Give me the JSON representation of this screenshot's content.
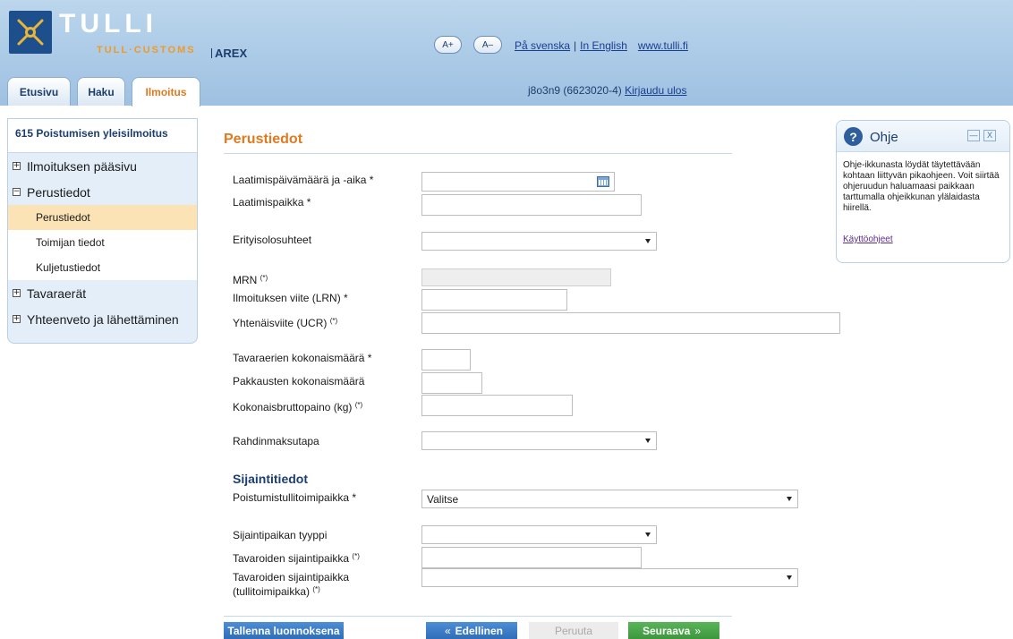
{
  "header": {
    "logo_title": "TULLI",
    "logo_sub": "TULL·CUSTOMS",
    "app_name": "AREX",
    "font_increase": "A+",
    "font_decrease": "A–",
    "lang_swedish": "På svenska",
    "lang_separator": "|",
    "lang_english": "In English",
    "site_link": "www.tulli.fi",
    "user": "j8o3n9 (6623020-4)",
    "logout": "Kirjaudu ulos",
    "tabs": [
      "Etusivu",
      "Haku",
      "Ilmoitus"
    ],
    "active_tab": "Ilmoitus"
  },
  "sidebar": {
    "title": "615 Poistumisen yleisilmoitus",
    "items": [
      {
        "label": "Ilmoituksen pääsivu",
        "toggle": "+"
      },
      {
        "label": "Perustiedot",
        "toggle": "−"
      },
      {
        "label": "Tavaraerät",
        "toggle": "+"
      },
      {
        "label": "Yhteenveto ja lähettäminen",
        "toggle": "+"
      }
    ],
    "subitems": [
      "Perustiedot",
      "Toimijan tiedot",
      "Kuljetustiedot"
    ],
    "active_subitem": "Perustiedot"
  },
  "form": {
    "section_title": "Perustiedot",
    "labels": {
      "date_time": "Laatimispäivämäärä ja -aika *",
      "place": "Laatimispaikka *",
      "special_circumstances": "Erityisolosuhteet",
      "mrn": "MRN",
      "lrn": "Ilmoituksen viite (LRN) *",
      "ucr": "Yhtenäisviite (UCR)",
      "total_items": "Tavaraerien kokonaismäärä *",
      "total_packages": "Pakkausten kokonaismäärä",
      "gross_weight": "Kokonaisbruttopaino (kg)",
      "freight_payment": "Rahdinmaksutapa",
      "exit_office": "Poistumistullitoimipaikka *",
      "location_type": "Sijaintipaikan tyyppi",
      "goods_location": "Tavaroiden sijaintipaikka",
      "goods_location_office_1": "Tavaroiden sijaintipaikka",
      "goods_location_office_2": "(tullitoimipaikka)",
      "conditional_marker": "(*)"
    },
    "subsection_title": "Sijaintitiedot",
    "values": {
      "date_time": "",
      "place": "",
      "special_circumstances": "",
      "mrn": "",
      "lrn": "",
      "ucr": "",
      "total_items": "",
      "total_packages": "",
      "gross_weight": "",
      "freight_payment": "",
      "exit_office": "Valitse",
      "location_type": "",
      "goods_location": "",
      "goods_location_office": ""
    },
    "buttons": {
      "save_draft": "Tallenna luonnoksena",
      "previous": "Edellinen",
      "cancel": "Peruuta",
      "next": "Seuraava"
    }
  },
  "help": {
    "title": "Ohje",
    "icon": "question-icon",
    "minimize": "—",
    "close": "X",
    "text": "Ohje-ikkunasta löydät täytettävään kohtaan liittyvän pikaohjeen. Voit siirtää ohjeruudun haluamaasi paikkaan tarttumalla ohjeikkunan ylälaidasta hiirellä.",
    "link": "Käyttöohjeet"
  },
  "colors": {
    "header_bg": "#a9c9e6",
    "brand_orange": "#e07a1f",
    "navy": "#1c3e6e",
    "active_nav": "#fbe3b6",
    "btn_blue": "#2f6db8",
    "btn_green": "#3d983d"
  }
}
